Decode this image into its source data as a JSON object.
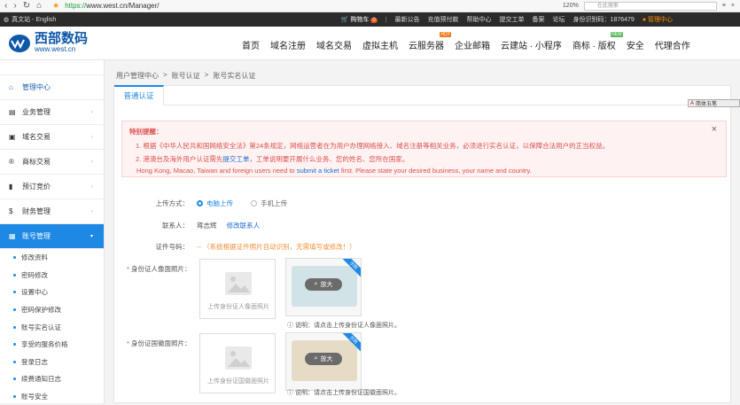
{
  "browser": {
    "url_scheme": "https://",
    "url_rest": "www.west.cn/Manager/",
    "zoom": "120%",
    "search_placeholder": "在此搜索"
  },
  "topbar": {
    "lang": "真文站 - English",
    "cart": "购物车",
    "cart_count": "0",
    "links": [
      "最新公告",
      "充值预付款",
      "帮助中心",
      "提交工单",
      "备案",
      "论坛"
    ],
    "id_label": "身份识别码：",
    "id_value": "1876479",
    "admin": "管理中心"
  },
  "header": {
    "brand": "西部数码",
    "domain": "www.west.cn",
    "menu": [
      "首页",
      "域名注册",
      "域名交易",
      "虚拟主机",
      "云服务器",
      "企业邮箱",
      "云建站 · 小程序",
      "商标 · 版权",
      "安全",
      "代理合作"
    ],
    "hot_tag": "HOT",
    "new_tag": "NEW"
  },
  "sidebar": {
    "items": [
      {
        "label": "管理中心",
        "icon": "home-icon"
      },
      {
        "label": "业务管理",
        "icon": "briefcase-icon"
      },
      {
        "label": "域名交易",
        "icon": "domain-icon"
      },
      {
        "label": "商标交易",
        "icon": "trademark-icon"
      },
      {
        "label": "预订竞价",
        "icon": "bars-icon"
      },
      {
        "label": "财务管理",
        "icon": "finance-icon"
      },
      {
        "label": "账号管理",
        "icon": "account-icon"
      }
    ],
    "subitems": [
      "修改资料",
      "密码修改",
      "设置中心",
      "密码保护修改",
      "账号实名认证",
      "享受的服务价格",
      "登录日志",
      "续费通知日志",
      "账号安全"
    ]
  },
  "breadcrumb": [
    "用户管理中心",
    ">",
    "账号认证",
    ">",
    "账号实名认证"
  ],
  "tab": "普通认证",
  "notice": {
    "title": "特别提醒：",
    "l1": "1. 根据《中华人民共和国网络安全法》第24条规定，网络运营者在为用户办理网络接入、域名注册等相关业务，必须进行实名认证，以保障合法用户的正当权益。",
    "l2a": "2. 港澳台及海外用户认证需先",
    "l2link": "提交工单",
    "l2b": "，工单说明要开展什么业务、您的姓名、您所在国家。",
    "l3a": "Hong Kong, Macao, Taiwan and foreign users need to ",
    "l3link": "submit a ticket",
    "l3b": " first. Please state your desired business, your name and country."
  },
  "form": {
    "upload_label": "上传方式：",
    "opt1": "电脑上传",
    "opt2": "手机上传",
    "contact_label": "联系人：",
    "contact": "蒋志辉",
    "contact_link": "修改联系人",
    "certno_label": "证件号码：",
    "certno_hint": "-- （系统根据证件照片自动识别，无需填写或修改！）",
    "front_label": "身份证人像面照片：",
    "front_cap": "上传身份证人像面照片",
    "back_label": "身份证国徽面照片：",
    "back_cap": "上传身份证国徽面照片",
    "sample_tag": "示例",
    "zoom": "放大",
    "front_tip": "说明：请点击上传身份证人像面照片。",
    "back_tip": "说明：请点击上传身份证国徽面照片。",
    "star": "*"
  },
  "float_btn": "简体五笔"
}
